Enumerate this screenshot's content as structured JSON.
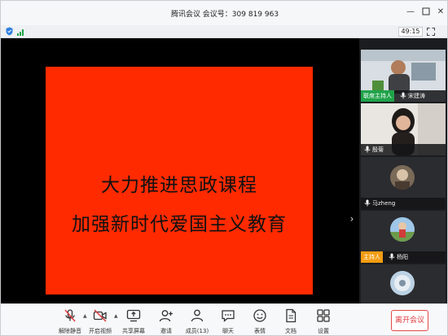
{
  "window": {
    "title": "腾讯会议  会议号：309 819 963",
    "minimize_glyph": "—",
    "close_glyph": "✕"
  },
  "status": {
    "timer": "49:15",
    "shield_icon": "shield-icon",
    "signal_icon": "signal-bars-icon",
    "fullscreen_icon": "fullscreen-icon"
  },
  "slide": {
    "line1": "大力推进思政课程",
    "line2": "加强新时代爱国主义教育",
    "background": "#ff2a00"
  },
  "sidebar": {
    "collapse_glyph": "›",
    "participants": [
      {
        "name": "宋建涛",
        "badge": "联席主持人",
        "badge_color": "#1fa34a"
      },
      {
        "name": "殷菊",
        "badge": ""
      },
      {
        "name": "马zheng",
        "badge": ""
      },
      {
        "name": "杨阳",
        "badge": "主持人",
        "badge_color": "#f39c12"
      },
      {
        "name": "",
        "badge": ""
      }
    ]
  },
  "toolbar": {
    "items": [
      {
        "label": "解除静音",
        "icon": "mic-muted-icon"
      },
      {
        "label": "开启视频",
        "icon": "video-off-icon"
      },
      {
        "label": "共享屏幕",
        "icon": "share-screen-icon"
      },
      {
        "label": "邀请",
        "icon": "invite-icon"
      },
      {
        "label": "成员(13)",
        "icon": "members-icon"
      },
      {
        "label": "聊天",
        "icon": "chat-icon"
      },
      {
        "label": "表情",
        "icon": "emoji-icon"
      },
      {
        "label": "文档",
        "icon": "document-icon"
      },
      {
        "label": "设置",
        "icon": "settings-icon"
      }
    ],
    "leave_label": "离开会议",
    "leave_color": "#e0393e"
  }
}
